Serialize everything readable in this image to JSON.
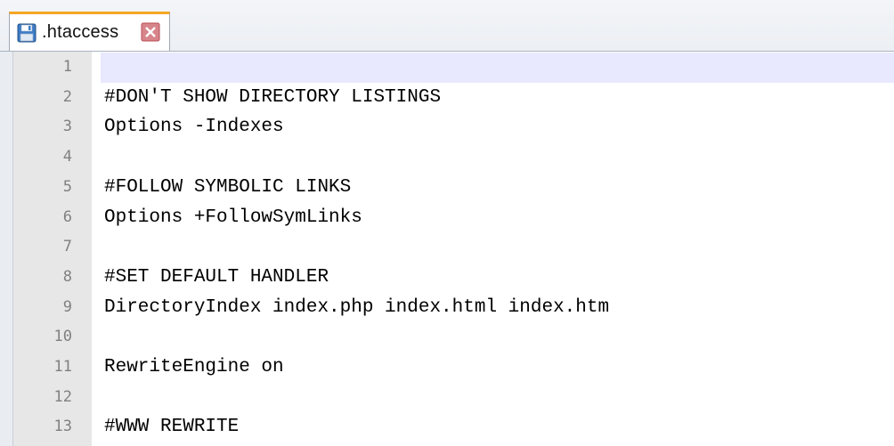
{
  "tab": {
    "filename": ".htaccess",
    "icon": "save-icon",
    "close_icon": "close-icon",
    "accent": "#f5a623"
  },
  "editor": {
    "current_line": 1,
    "current_line_color": "#e8e8ff",
    "lines": [
      {
        "number": "1",
        "text": ""
      },
      {
        "number": "2",
        "text": "#DON'T SHOW DIRECTORY LISTINGS"
      },
      {
        "number": "3",
        "text": "Options -Indexes"
      },
      {
        "number": "4",
        "text": ""
      },
      {
        "number": "5",
        "text": "#FOLLOW SYMBOLIC LINKS"
      },
      {
        "number": "6",
        "text": "Options +FollowSymLinks"
      },
      {
        "number": "7",
        "text": ""
      },
      {
        "number": "8",
        "text": "#SET DEFAULT HANDLER"
      },
      {
        "number": "9",
        "text": "DirectoryIndex index.php index.html index.htm"
      },
      {
        "number": "10",
        "text": ""
      },
      {
        "number": "11",
        "text": "RewriteEngine on"
      },
      {
        "number": "12",
        "text": ""
      },
      {
        "number": "13",
        "text": "#WWW REWRITE"
      }
    ]
  }
}
